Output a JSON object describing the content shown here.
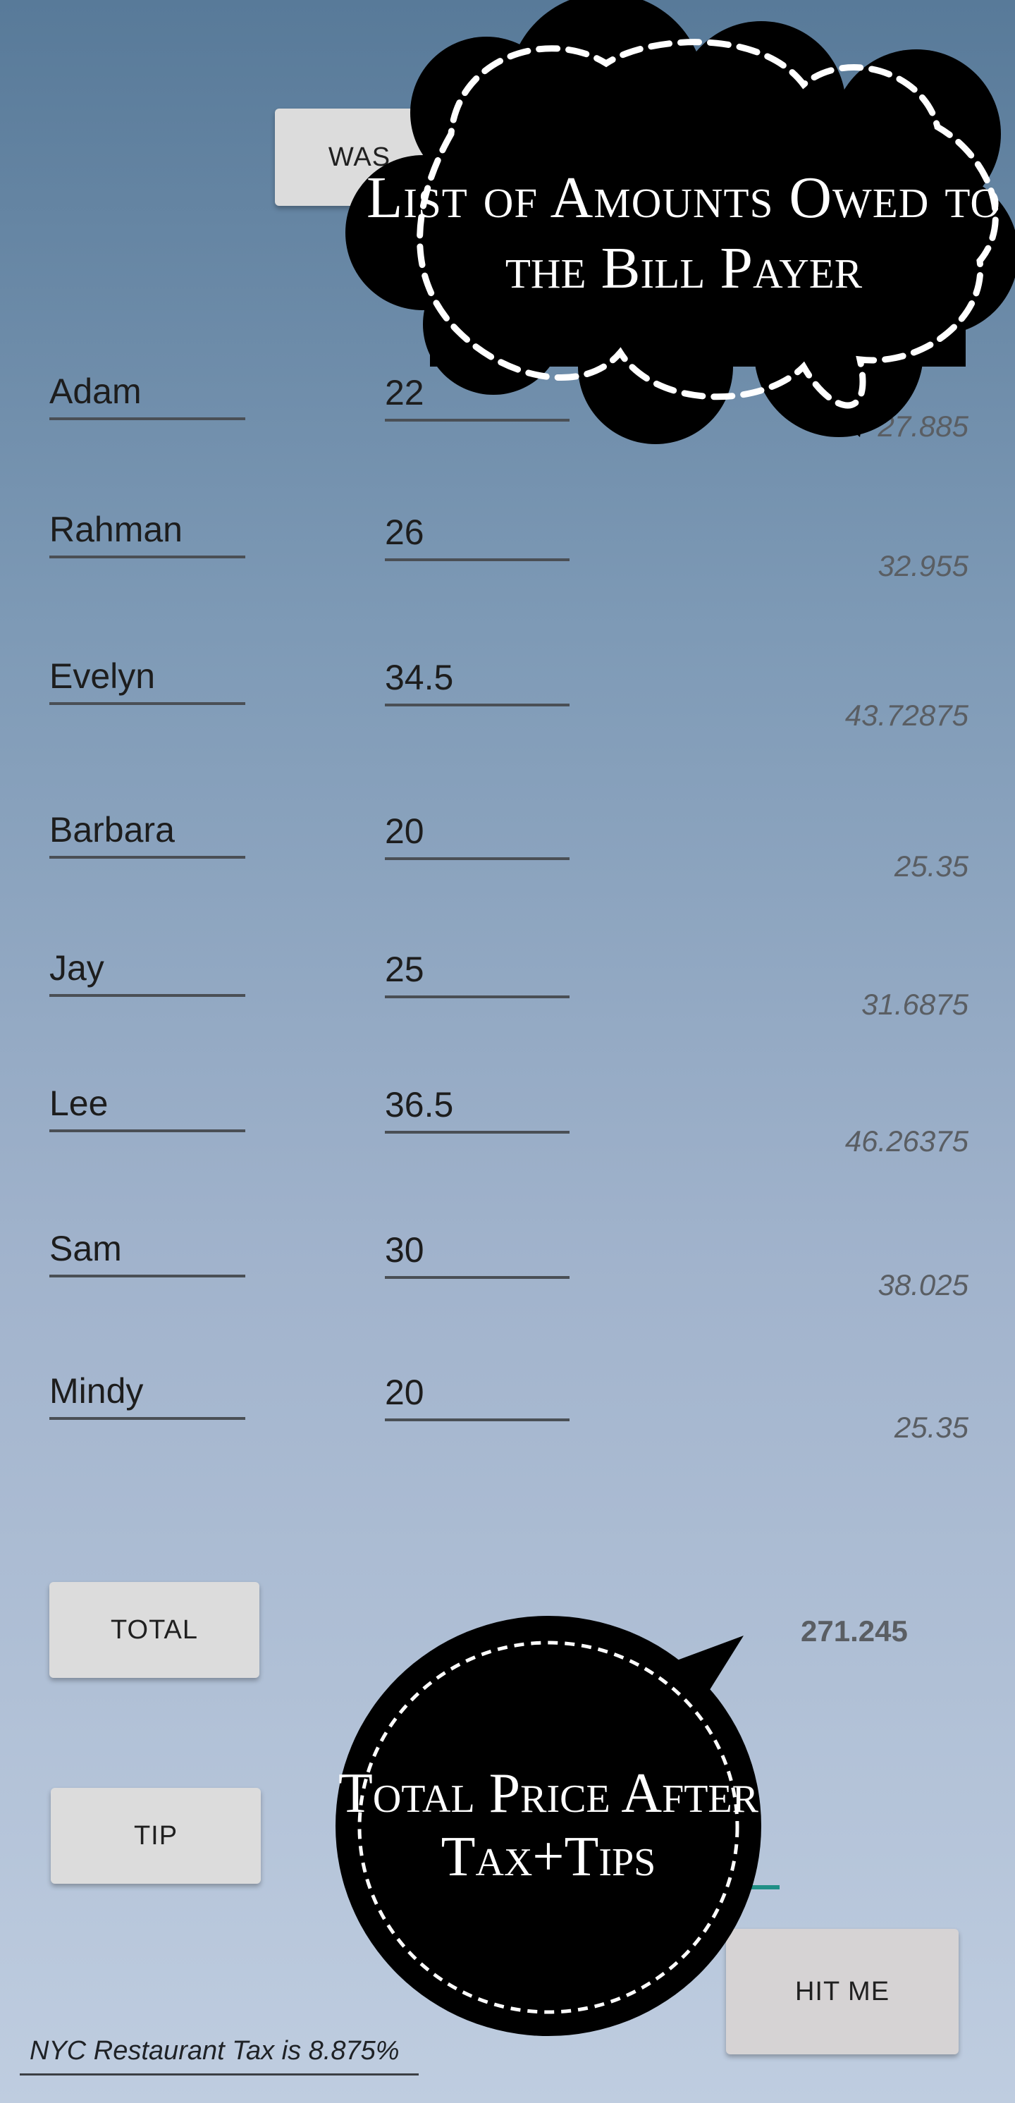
{
  "buttons": {
    "was_label": "WAS",
    "total_label": "TOTAL",
    "tip_label": "TIP",
    "hit_me_label": "HIT ME"
  },
  "rows": [
    {
      "name": "Adam",
      "amount": "22",
      "owed": "27.885"
    },
    {
      "name": "Rahman",
      "amount": "26",
      "owed": "32.955"
    },
    {
      "name": "Evelyn",
      "amount": "34.5",
      "owed": "43.72875"
    },
    {
      "name": "Barbara",
      "amount": "20",
      "owed": "25.35"
    },
    {
      "name": "Jay",
      "amount": "25",
      "owed": "31.6875"
    },
    {
      "name": "Lee",
      "amount": "36.5",
      "owed": "46.26375"
    },
    {
      "name": "Sam",
      "amount": "30",
      "owed": "38.025"
    },
    {
      "name": "Mindy",
      "amount": "20",
      "owed": "25.35"
    }
  ],
  "total_value": "271.245",
  "tax_note": "NYC Restaurant Tax is 8.875%",
  "callouts": {
    "top_line1": "List of Amounts Owed to",
    "top_line2": "the Bill Payer",
    "bottom_line1": "Total Price After",
    "bottom_line2": "Tax+Tips"
  },
  "colors": {
    "accent_underline": "#1f8f86",
    "bubble_fill": "#000000",
    "bubble_dash": "#ffffff"
  }
}
